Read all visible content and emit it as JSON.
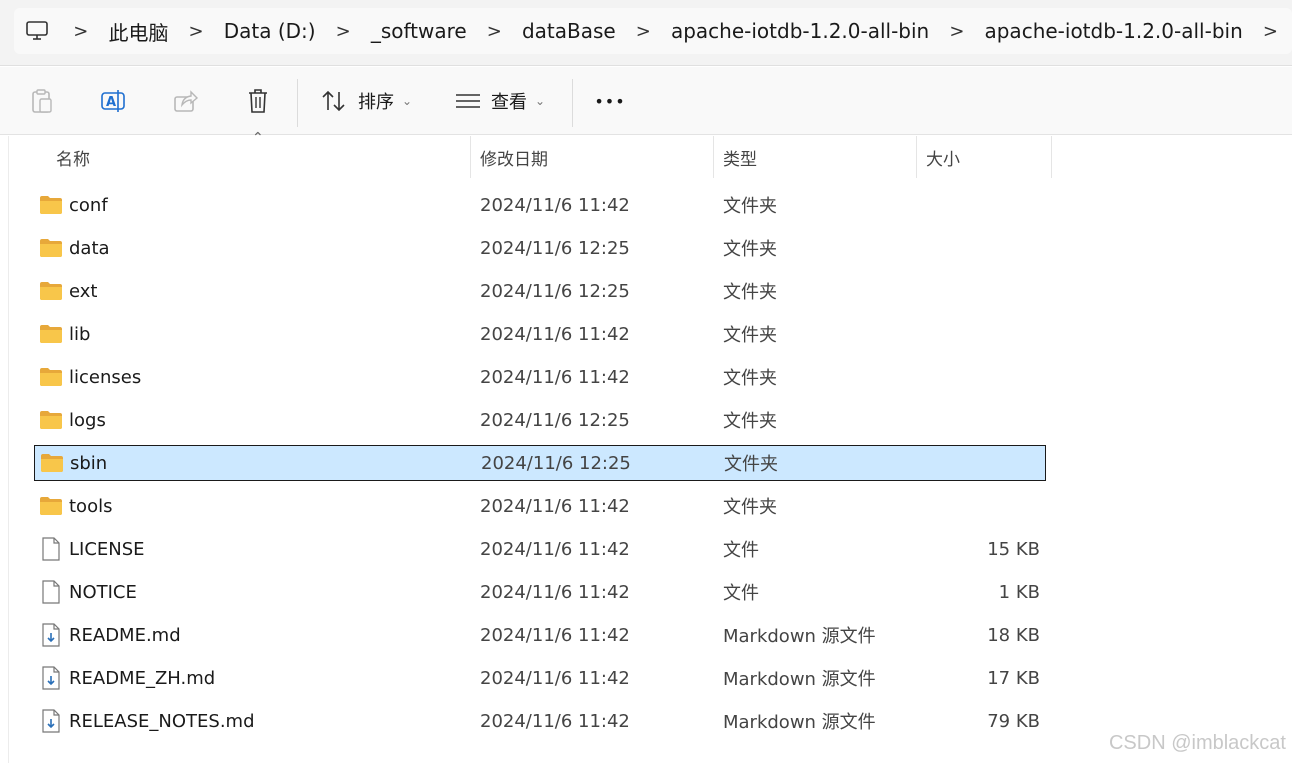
{
  "breadcrumb": {
    "items": [
      "此电脑",
      "Data (D:)",
      "_software",
      "dataBase",
      "apache-iotdb-1.2.0-all-bin",
      "apache-iotdb-1.2.0-all-bin"
    ],
    "separator": ">"
  },
  "toolbar": {
    "sort_label": "排序",
    "view_label": "查看",
    "more_label": "•••"
  },
  "columns": {
    "name": "名称",
    "date": "修改日期",
    "type": "类型",
    "size": "大小"
  },
  "files": [
    {
      "name": "conf",
      "date": "2024/11/6 11:42",
      "type": "文件夹",
      "size": "",
      "icon": "folder-icon"
    },
    {
      "name": "data",
      "date": "2024/11/6 12:25",
      "type": "文件夹",
      "size": "",
      "icon": "folder-icon"
    },
    {
      "name": "ext",
      "date": "2024/11/6 12:25",
      "type": "文件夹",
      "size": "",
      "icon": "folder-icon"
    },
    {
      "name": "lib",
      "date": "2024/11/6 11:42",
      "type": "文件夹",
      "size": "",
      "icon": "folder-icon"
    },
    {
      "name": "licenses",
      "date": "2024/11/6 11:42",
      "type": "文件夹",
      "size": "",
      "icon": "folder-icon"
    },
    {
      "name": "logs",
      "date": "2024/11/6 12:25",
      "type": "文件夹",
      "size": "",
      "icon": "folder-icon"
    },
    {
      "name": "sbin",
      "date": "2024/11/6 12:25",
      "type": "文件夹",
      "size": "",
      "icon": "folder-icon",
      "selected": true
    },
    {
      "name": "tools",
      "date": "2024/11/6 11:42",
      "type": "文件夹",
      "size": "",
      "icon": "folder-icon"
    },
    {
      "name": "LICENSE",
      "date": "2024/11/6 11:42",
      "type": "文件",
      "size": "15 KB",
      "icon": "file-icon"
    },
    {
      "name": "NOTICE",
      "date": "2024/11/6 11:42",
      "type": "文件",
      "size": "1 KB",
      "icon": "file-icon"
    },
    {
      "name": "README.md",
      "date": "2024/11/6 11:42",
      "type": "Markdown 源文件",
      "size": "18 KB",
      "icon": "markdown-file-icon"
    },
    {
      "name": "README_ZH.md",
      "date": "2024/11/6 11:42",
      "type": "Markdown 源文件",
      "size": "17 KB",
      "icon": "markdown-file-icon"
    },
    {
      "name": "RELEASE_NOTES.md",
      "date": "2024/11/6 11:42",
      "type": "Markdown 源文件",
      "size": "79 KB",
      "icon": "markdown-file-icon"
    }
  ],
  "watermark": "CSDN @imblackcat",
  "colors": {
    "selection": "#cce8ff",
    "folder": "#f8c64a",
    "accent": "#1e6fd0"
  }
}
